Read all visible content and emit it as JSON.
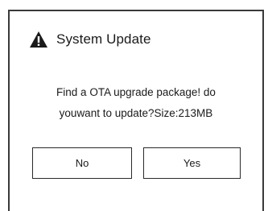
{
  "dialog": {
    "title": "System Update",
    "title_icon": "warning-triangle-icon",
    "message_line1": "Find a OTA upgrade package! do",
    "message_line2": "youwant to update?Size:213MB",
    "buttons": {
      "no_label": "No",
      "yes_label": "Yes"
    }
  }
}
